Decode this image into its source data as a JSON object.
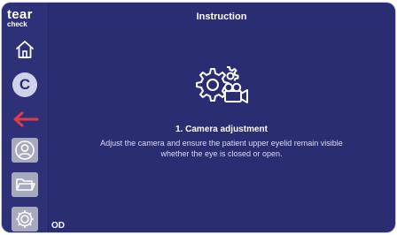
{
  "app": {
    "logo_line1": "tear",
    "logo_line2": "check"
  },
  "header": {
    "title": "Instruction"
  },
  "sidebar": {
    "items": [
      {
        "icon": "home-icon"
      },
      {
        "icon": "c-badge",
        "label": "C"
      },
      {
        "icon": "back-arrow-icon",
        "color": "#e23b4c"
      },
      {
        "icon": "profile-icon"
      },
      {
        "icon": "folder-icon"
      },
      {
        "icon": "settings-icon"
      }
    ]
  },
  "main": {
    "icon": "camera-adjust-icon",
    "step_title": "1. Camera adjustment",
    "step_desc_line1": "Adjust the camera and ensure the patient upper eyelid remain visible",
    "step_desc_line2": "whether the eye is closed or open."
  },
  "footer": {
    "eye_label": "OD"
  },
  "colors": {
    "background": "#2b2d73",
    "accent_red": "#e23b4c",
    "button_gray": "#a7a9bd"
  }
}
